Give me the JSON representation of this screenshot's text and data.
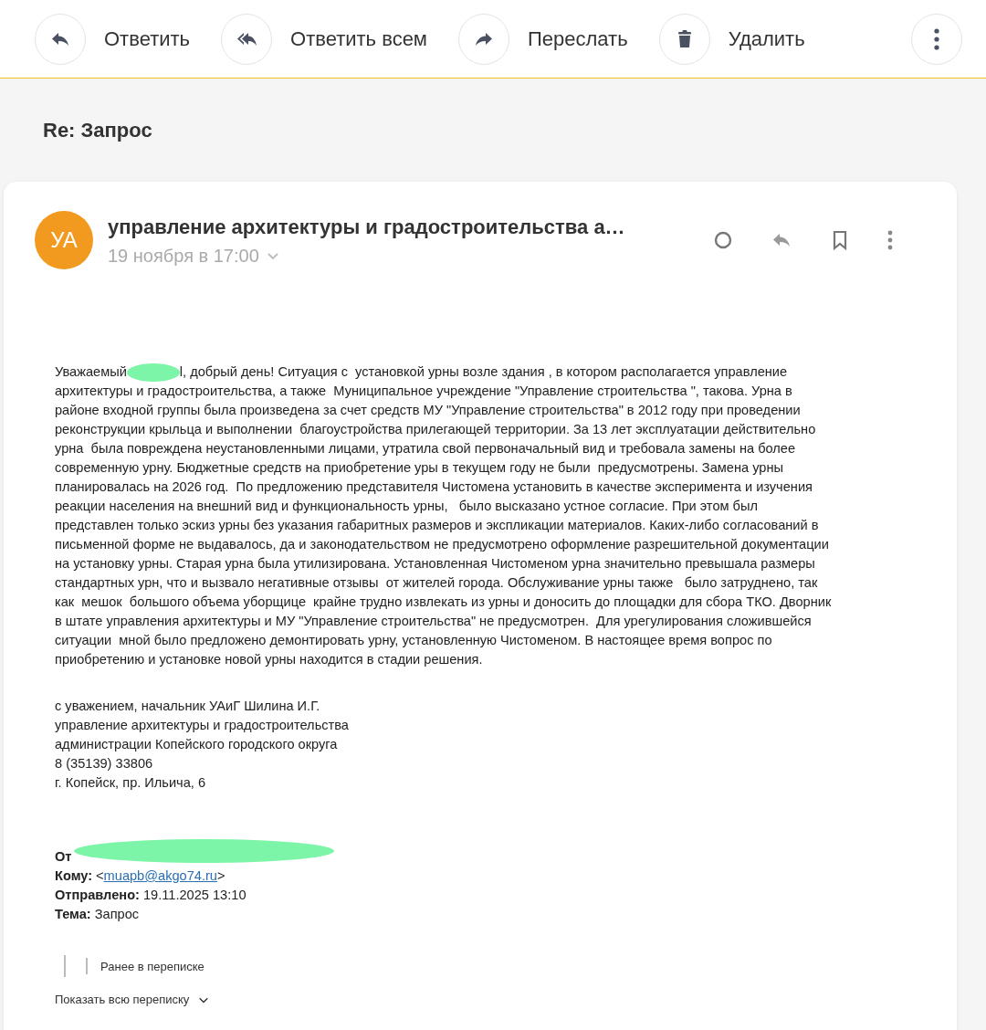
{
  "toolbar": {
    "buttons": [
      {
        "kind": "reply",
        "label": "Ответить"
      },
      {
        "kind": "reply_all",
        "label": "Ответить всем"
      },
      {
        "kind": "forward",
        "label": "Переслать"
      },
      {
        "kind": "delete",
        "label": "Удалить"
      }
    ],
    "more": true
  },
  "subject": "Re: Запрос",
  "message": {
    "avatar": {
      "initials": "УА",
      "color": "#f29a1f"
    },
    "sender": "управление архитектуры и градостроительства а…",
    "date": "19 ноября в 17:00",
    "actions": [
      {
        "kind": "unread"
      },
      {
        "kind": "reply"
      },
      {
        "kind": "bookmark"
      },
      {
        "kind": "more"
      }
    ],
    "greeting": "Уважаемый",
    "greeting_redacted": true,
    "body_lines": [
      "l, добрый день! Ситуация с  установкой урны возле здания , в котором располагается управление",
      "архитектуры и градостроительства, а также  Муниципальное учреждение \"Управление строительства \", такова. Урна в",
      "районе входной группы была произведена за счет средств МУ \"Управление строительства\" в 2012 году при проведении",
      "реконструкции крыльца и выполнении  благоустройства прилегающей территории. За 13 лет эксплуатации действительно",
      "урна  была повреждена неустановленными лицами, утратила свой первоначальный вид и требовала замены на более",
      "современную урну. Бюджетные средств на приобретение уры в текущем году не были  предусмотрены. Замена урны",
      "планировалась на 2026 год.  По предложению представителя Чистомена установить в качестве эксперимента и изучения",
      "реакции населения на внешний вид и функциональность урны,   было высказано устное согласие. При этом был",
      "представлен только эскиз урны без указания габаритных размеров и экспликации материалов. Каких-либо согласований в",
      "письменной форме не выдавалось, да и законодательством не предусмотрено оформление разрешительной документации",
      "на установку урны. Старая урна была утилизирована. Установленная Чистоменом урна значительно превышала размеры",
      "стандартных урн, что и вызвало негативные отзывы  от жителей города. Обслуживание урны также   было затруднено, так",
      "как  мешок  большого объема уборщице  крайне трудно извлекать из урны и доносить до площадки для сбора ТКО. Дворник",
      "в штате управления архитектуры и МУ \"Управление строительства\" не предусмотрен.  Для урегулирования сложившейся",
      "ситуации  мной было предложено демонтировать урну, установленную Чистоменом. В настоящее время вопрос по",
      "приобретению и установке новой урны находится в стадии решения."
    ],
    "signature": [
      "с уважением, начальник УАиГ Шилина И.Г.",
      "управление архитектуры и градостроительства",
      "администрации Копейского городского округа",
      "8 (35139) 33806",
      "г. Копейск, пр. Ильича, 6"
    ],
    "quoted_header": [
      {
        "label": "От",
        "redacted": true
      },
      {
        "label": "Кому:",
        "before": " <",
        "link": "muapb@akgo74.ru",
        "after": ">"
      },
      {
        "label": "Отправлено:",
        "value": " 19.11.2025 13:10"
      },
      {
        "label": "Тема:",
        "value": " Запрос"
      }
    ],
    "earlier": "Ранее в переписке",
    "show_all": "Показать всю переписку"
  }
}
